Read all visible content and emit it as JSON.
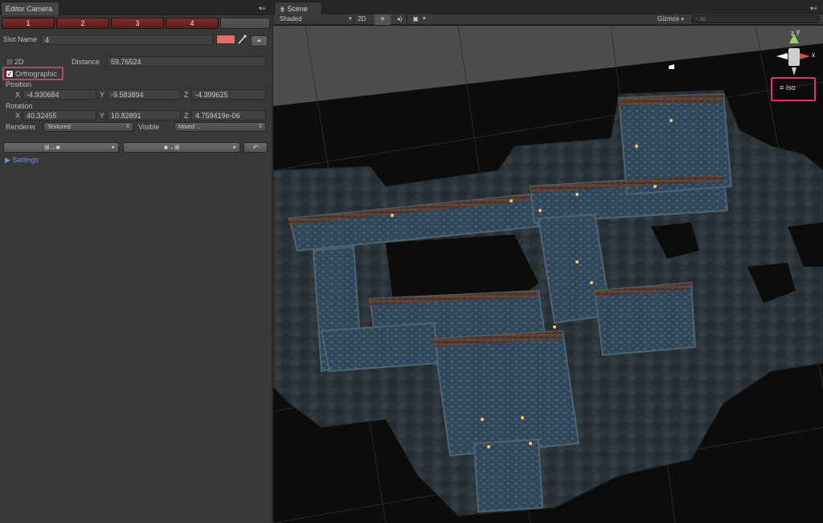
{
  "left_panel": {
    "tab_title": "Editor Camera",
    "slots": [
      "1",
      "2",
      "3",
      "4"
    ],
    "slot_name_label": "Slot Name",
    "slot_name_value": "4",
    "swatch_color": "#e66d6d",
    "mode_2d_label": "2D",
    "distance_label": "Distance",
    "distance_value": "59.76524",
    "orthographic_label": "Orthographic",
    "orthographic_checked": true,
    "position_label": "Position",
    "position": {
      "x_label": "X",
      "x": "-4.930684",
      "y_label": "Y",
      "y": "-9.583894",
      "z_label": "Z",
      "z": "-4.399625"
    },
    "rotation_label": "Rotation",
    "rotation": {
      "x_label": "X",
      "x": "40.32455",
      "y_label": "Y",
      "y": "10.82891",
      "z_label": "Z",
      "z": "4.759419e-06"
    },
    "renderer_label": "Renderer",
    "renderer_value": "Textured",
    "visible_label": "Visible",
    "visible_value": "Mixed ...",
    "settings_label": "Settings"
  },
  "scene": {
    "tab_title": "Scene",
    "shading_mode": "Shaded",
    "toggle_2d": "2D",
    "gizmos_label": "Gizmos",
    "search_placeholder": "All",
    "projection_label": "Iso",
    "gizmo_axes": {
      "x": "x",
      "y": "y",
      "z": "z"
    }
  },
  "colors": {
    "highlight": "#d8366c",
    "slot_button": "#6e2626",
    "link": "#6d8fd6"
  }
}
